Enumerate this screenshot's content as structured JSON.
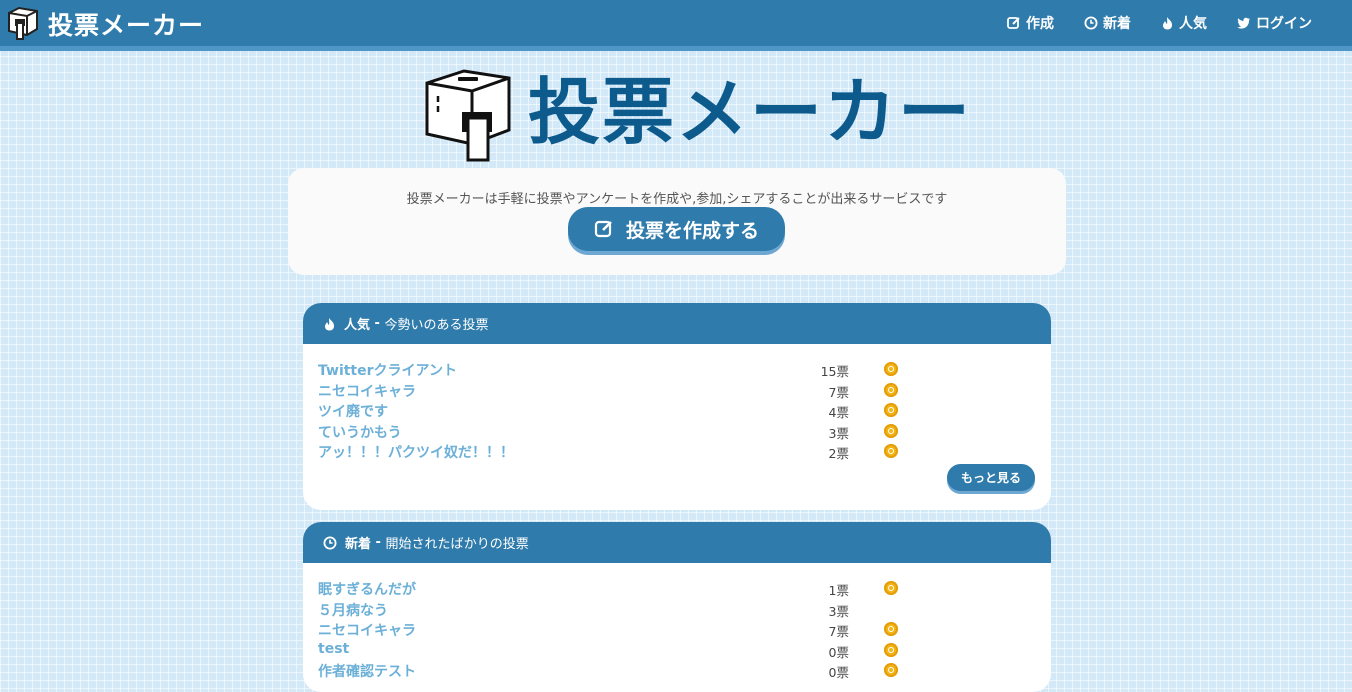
{
  "brand": {
    "title": "投票メーカー"
  },
  "nav": [
    {
      "label": "作成",
      "icon": "edit-icon"
    },
    {
      "label": "新着",
      "icon": "clock-icon"
    },
    {
      "label": "人気",
      "icon": "fire-icon"
    },
    {
      "label": "ログイン",
      "icon": "twitter-icon"
    }
  ],
  "hero": {
    "title": "投票メーカー"
  },
  "intro": {
    "text": "投票メーカーは手軽に投票やアンケートを作成や,参加,シェアすることが出来るサービスです",
    "create_button": "投票を作成する"
  },
  "popular": {
    "title": "人気",
    "separator": " - ",
    "subtitle": "今勢いのある投票",
    "more_button": "もっと見る",
    "items": [
      {
        "title": "Twitterクライアント",
        "count": "15票",
        "coin": true
      },
      {
        "title": "ニセコイキャラ",
        "count": "7票",
        "coin": true
      },
      {
        "title": "ツイ廃です",
        "count": "4票",
        "coin": true
      },
      {
        "title": "ていうかもう",
        "count": "3票",
        "coin": true
      },
      {
        "title": "アッ！！！パクツイ奴だ！！！",
        "count": "2票",
        "coin": true
      }
    ]
  },
  "recent": {
    "title": "新着",
    "separator": " - ",
    "subtitle": "開始されたばかりの投票",
    "items": [
      {
        "title": "眠すぎるんだが",
        "count": "1票",
        "coin": true
      },
      {
        "title": "５月病なう",
        "count": "3票",
        "coin": false
      },
      {
        "title": "ニセコイキャラ",
        "count": "7票",
        "coin": true
      },
      {
        "title": "test",
        "count": "0票",
        "coin": true
      },
      {
        "title": "作者確認テスト",
        "count": "0票",
        "coin": true
      }
    ]
  },
  "colors": {
    "primary": "#2f7bab",
    "primary_shadow": "#6ea8d2",
    "hero_text": "#0d5b8c",
    "link": "#6cb0d8",
    "coin": "#f3b515",
    "background": "#d3e9f8"
  }
}
